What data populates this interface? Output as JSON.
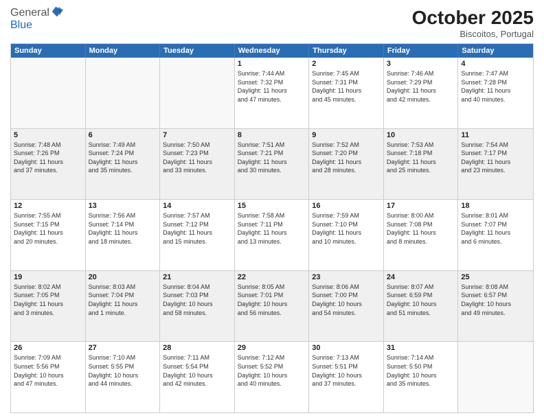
{
  "header": {
    "logo": {
      "line1": "General",
      "line2": "Blue"
    },
    "month": "October 2025",
    "location": "Biscoitos, Portugal"
  },
  "weekdays": [
    "Sunday",
    "Monday",
    "Tuesday",
    "Wednesday",
    "Thursday",
    "Friday",
    "Saturday"
  ],
  "rows": [
    [
      {
        "day": "",
        "info": "",
        "empty": true
      },
      {
        "day": "",
        "info": "",
        "empty": true
      },
      {
        "day": "",
        "info": "",
        "empty": true
      },
      {
        "day": "1",
        "info": "Sunrise: 7:44 AM\nSunset: 7:32 PM\nDaylight: 11 hours\nand 47 minutes."
      },
      {
        "day": "2",
        "info": "Sunrise: 7:45 AM\nSunset: 7:31 PM\nDaylight: 11 hours\nand 45 minutes."
      },
      {
        "day": "3",
        "info": "Sunrise: 7:46 AM\nSunset: 7:29 PM\nDaylight: 11 hours\nand 42 minutes."
      },
      {
        "day": "4",
        "info": "Sunrise: 7:47 AM\nSunset: 7:28 PM\nDaylight: 11 hours\nand 40 minutes."
      }
    ],
    [
      {
        "day": "5",
        "info": "Sunrise: 7:48 AM\nSunset: 7:26 PM\nDaylight: 11 hours\nand 37 minutes."
      },
      {
        "day": "6",
        "info": "Sunrise: 7:49 AM\nSunset: 7:24 PM\nDaylight: 11 hours\nand 35 minutes."
      },
      {
        "day": "7",
        "info": "Sunrise: 7:50 AM\nSunset: 7:23 PM\nDaylight: 11 hours\nand 33 minutes."
      },
      {
        "day": "8",
        "info": "Sunrise: 7:51 AM\nSunset: 7:21 PM\nDaylight: 11 hours\nand 30 minutes."
      },
      {
        "day": "9",
        "info": "Sunrise: 7:52 AM\nSunset: 7:20 PM\nDaylight: 11 hours\nand 28 minutes."
      },
      {
        "day": "10",
        "info": "Sunrise: 7:53 AM\nSunset: 7:18 PM\nDaylight: 11 hours\nand 25 minutes."
      },
      {
        "day": "11",
        "info": "Sunrise: 7:54 AM\nSunset: 7:17 PM\nDaylight: 11 hours\nand 23 minutes."
      }
    ],
    [
      {
        "day": "12",
        "info": "Sunrise: 7:55 AM\nSunset: 7:15 PM\nDaylight: 11 hours\nand 20 minutes."
      },
      {
        "day": "13",
        "info": "Sunrise: 7:56 AM\nSunset: 7:14 PM\nDaylight: 11 hours\nand 18 minutes."
      },
      {
        "day": "14",
        "info": "Sunrise: 7:57 AM\nSunset: 7:12 PM\nDaylight: 11 hours\nand 15 minutes."
      },
      {
        "day": "15",
        "info": "Sunrise: 7:58 AM\nSunset: 7:11 PM\nDaylight: 11 hours\nand 13 minutes."
      },
      {
        "day": "16",
        "info": "Sunrise: 7:59 AM\nSunset: 7:10 PM\nDaylight: 11 hours\nand 10 minutes."
      },
      {
        "day": "17",
        "info": "Sunrise: 8:00 AM\nSunset: 7:08 PM\nDaylight: 11 hours\nand 8 minutes."
      },
      {
        "day": "18",
        "info": "Sunrise: 8:01 AM\nSunset: 7:07 PM\nDaylight: 11 hours\nand 6 minutes."
      }
    ],
    [
      {
        "day": "19",
        "info": "Sunrise: 8:02 AM\nSunset: 7:05 PM\nDaylight: 11 hours\nand 3 minutes."
      },
      {
        "day": "20",
        "info": "Sunrise: 8:03 AM\nSunset: 7:04 PM\nDaylight: 11 hours\nand 1 minute."
      },
      {
        "day": "21",
        "info": "Sunrise: 8:04 AM\nSunset: 7:03 PM\nDaylight: 10 hours\nand 58 minutes."
      },
      {
        "day": "22",
        "info": "Sunrise: 8:05 AM\nSunset: 7:01 PM\nDaylight: 10 hours\nand 56 minutes."
      },
      {
        "day": "23",
        "info": "Sunrise: 8:06 AM\nSunset: 7:00 PM\nDaylight: 10 hours\nand 54 minutes."
      },
      {
        "day": "24",
        "info": "Sunrise: 8:07 AM\nSunset: 6:59 PM\nDaylight: 10 hours\nand 51 minutes."
      },
      {
        "day": "25",
        "info": "Sunrise: 8:08 AM\nSunset: 6:57 PM\nDaylight: 10 hours\nand 49 minutes."
      }
    ],
    [
      {
        "day": "26",
        "info": "Sunrise: 7:09 AM\nSunset: 5:56 PM\nDaylight: 10 hours\nand 47 minutes."
      },
      {
        "day": "27",
        "info": "Sunrise: 7:10 AM\nSunset: 5:55 PM\nDaylight: 10 hours\nand 44 minutes."
      },
      {
        "day": "28",
        "info": "Sunrise: 7:11 AM\nSunset: 5:54 PM\nDaylight: 10 hours\nand 42 minutes."
      },
      {
        "day": "29",
        "info": "Sunrise: 7:12 AM\nSunset: 5:52 PM\nDaylight: 10 hours\nand 40 minutes."
      },
      {
        "day": "30",
        "info": "Sunrise: 7:13 AM\nSunset: 5:51 PM\nDaylight: 10 hours\nand 37 minutes."
      },
      {
        "day": "31",
        "info": "Sunrise: 7:14 AM\nSunset: 5:50 PM\nDaylight: 10 hours\nand 35 minutes."
      },
      {
        "day": "",
        "info": "",
        "empty": true
      }
    ]
  ]
}
